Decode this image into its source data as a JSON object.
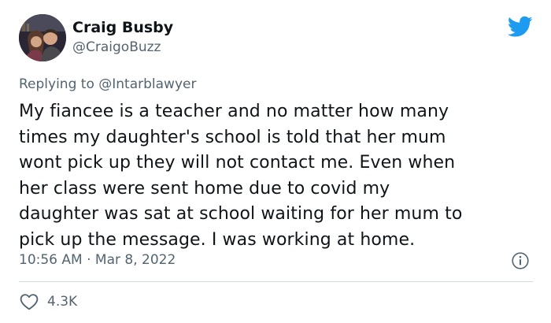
{
  "tweet": {
    "author": {
      "display_name": "Craig Busby",
      "handle": "@CraigoBuzz",
      "avatar_icon": "avatar-photo"
    },
    "brand_icon": "twitter-bird-icon",
    "brand_color": "#1d9bf0",
    "replying_prefix": "Replying to",
    "replying_to": "@Intarblawyer",
    "text_lines": [
      "My fiancee is a teacher and no matter how many",
      "times my daughter's school is told that her mum",
      "wont pick up they will not contact me. Even when",
      "her class were sent home due to covid my",
      "daughter was sat at school waiting for her mum to",
      "pick up the message. I was working at home."
    ],
    "timestamp": "10:56 AM · Mar 8, 2022",
    "info_icon": "info-icon",
    "like_icon": "heart-icon",
    "like_count": "4.3K"
  }
}
